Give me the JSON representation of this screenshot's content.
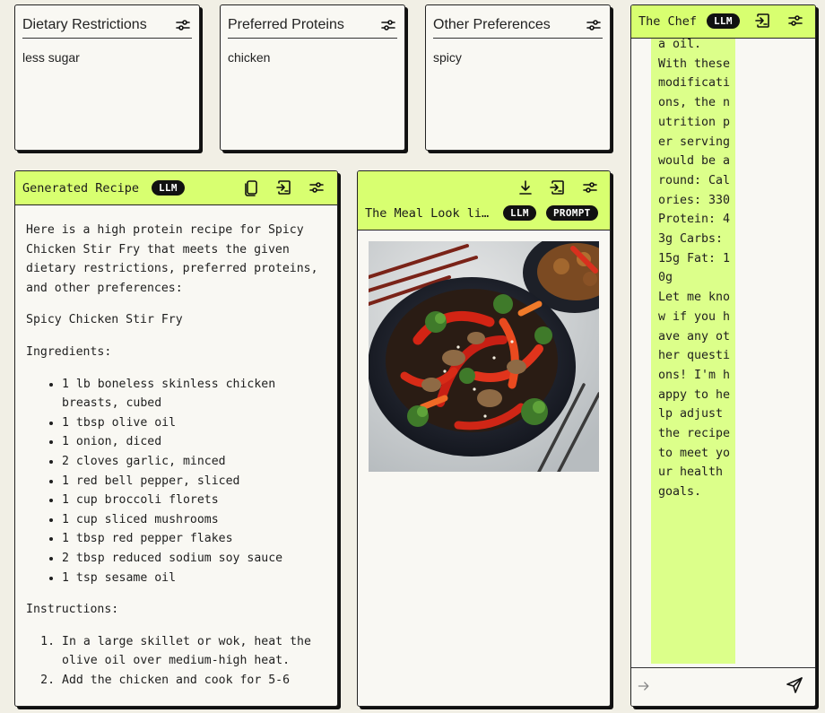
{
  "preferences": [
    {
      "title": "Dietary Restrictions",
      "value": "less sugar"
    },
    {
      "title": "Preferred Proteins",
      "value": "chicken"
    },
    {
      "title": "Other Preferences",
      "value": "spicy"
    }
  ],
  "recipe": {
    "title": "Generated Recipe",
    "badge": "LLM",
    "intro": "Here is a high protein recipe for Spicy Chicken Stir Fry that meets the given dietary restrictions, preferred proteins, and other preferences:",
    "name": "Spicy Chicken Stir Fry",
    "ingredients_heading": "Ingredients:",
    "ingredients": [
      "1 lb boneless skinless chicken breasts, cubed",
      "1 tbsp olive oil",
      "1 onion, diced",
      "2 cloves garlic, minced",
      "1 red bell pepper, sliced",
      "1 cup broccoli florets",
      "1 cup sliced mushrooms",
      "1 tbsp red pepper flakes",
      "2 tbsp reduced sodium soy sauce",
      "1 tsp sesame oil"
    ],
    "instructions_heading": "Instructions:",
    "instructions": [
      "In a large skillet or wok, heat the olive oil over medium-high heat.",
      "Add the chicken and cook for 5-6"
    ]
  },
  "meal": {
    "title": "The Meal Look li…",
    "badges": [
      "LLM",
      "PROMPT"
    ]
  },
  "chef": {
    "title": "The Chef",
    "badge": "LLM",
    "message": "a oil.\nWith these modifications, the nutrition per serving would be around: Calories: 330 Protein: 43g Carbs: 15g Fat: 10g\nLet me know if you have any other questions! I'm happy to help adjust the recipe to meet your health goals."
  },
  "colors": {
    "accent": "#d8ff70",
    "bubble": "#dcff8a",
    "background": "#f1efe5"
  }
}
